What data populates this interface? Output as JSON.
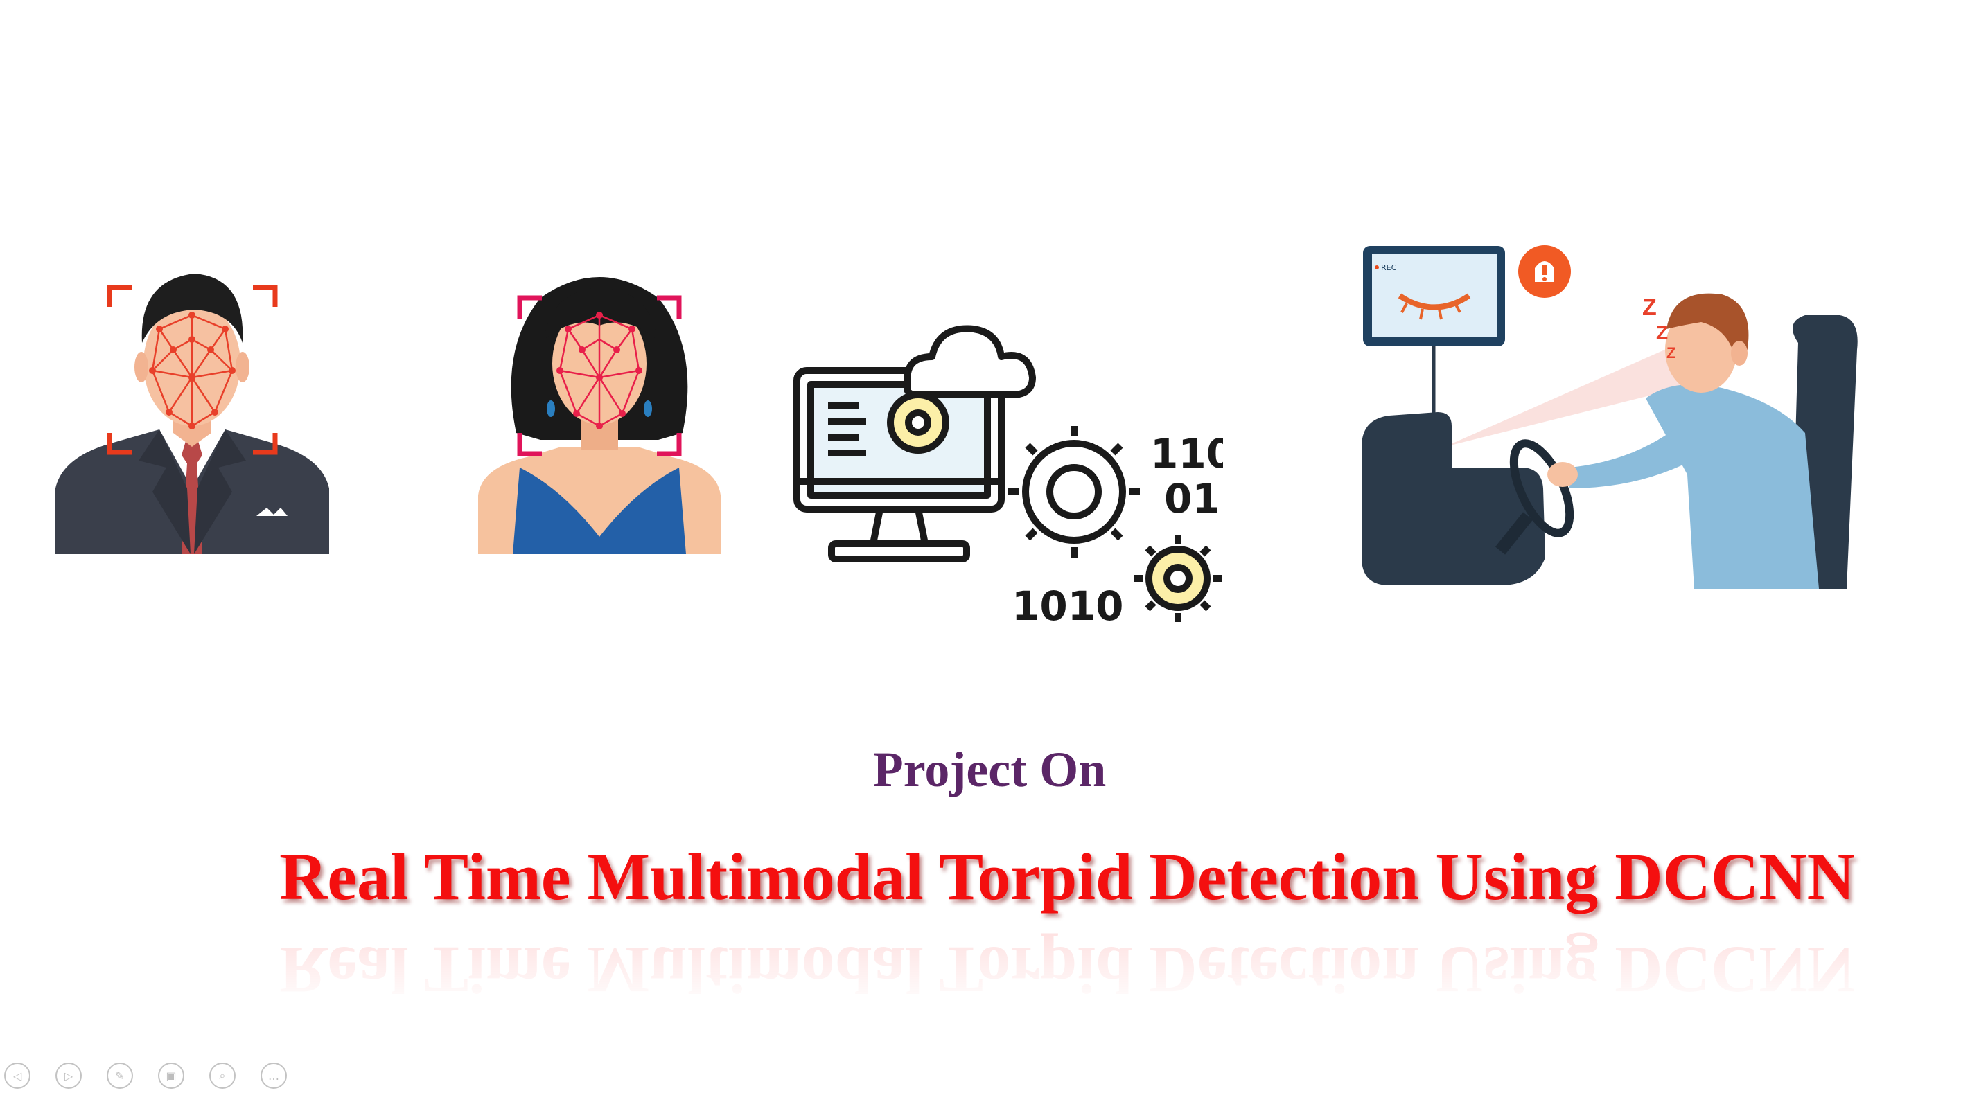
{
  "slide": {
    "subtitle": "Project On",
    "title": "Real Time Multimodal Torpid Detection Using DCCNN",
    "colors": {
      "subtitle": "#5b2667",
      "title": "#f40f0f",
      "face_mesh": "#e8402a",
      "suit": "#3a3f4b",
      "gear_yellow": "#fcefa8",
      "car_dark": "#2b3a4a",
      "shirt_blue": "#8bbcdb"
    },
    "illustrations": [
      {
        "name": "man-face-scan",
        "icon": "face-detection-male-icon"
      },
      {
        "name": "woman-face-scan",
        "icon": "face-detection-female-icon"
      },
      {
        "name": "computer-processing",
        "icon": "computer-gears-cloud-icon"
      },
      {
        "name": "drowsy-driver",
        "icon": "drowsy-driver-alert-icon"
      }
    ],
    "computer_binary": {
      "top": "110",
      "middle": "01",
      "bottom": "1010"
    },
    "monitor_rec_label": "REC",
    "sleep_letters": [
      "Z",
      "Z",
      "Z"
    ]
  },
  "toolbar": {
    "buttons": [
      {
        "name": "previous-slide-button",
        "icon": "prev-icon",
        "glyph": "◁"
      },
      {
        "name": "next-slide-button",
        "icon": "next-icon",
        "glyph": "▷"
      },
      {
        "name": "pen-tool-button",
        "icon": "pen-icon",
        "glyph": "✎"
      },
      {
        "name": "slides-view-button",
        "icon": "slides-icon",
        "glyph": "▣"
      },
      {
        "name": "zoom-button",
        "icon": "zoom-icon",
        "glyph": "⌕"
      },
      {
        "name": "more-options-button",
        "icon": "more-icon",
        "glyph": "…"
      }
    ]
  }
}
